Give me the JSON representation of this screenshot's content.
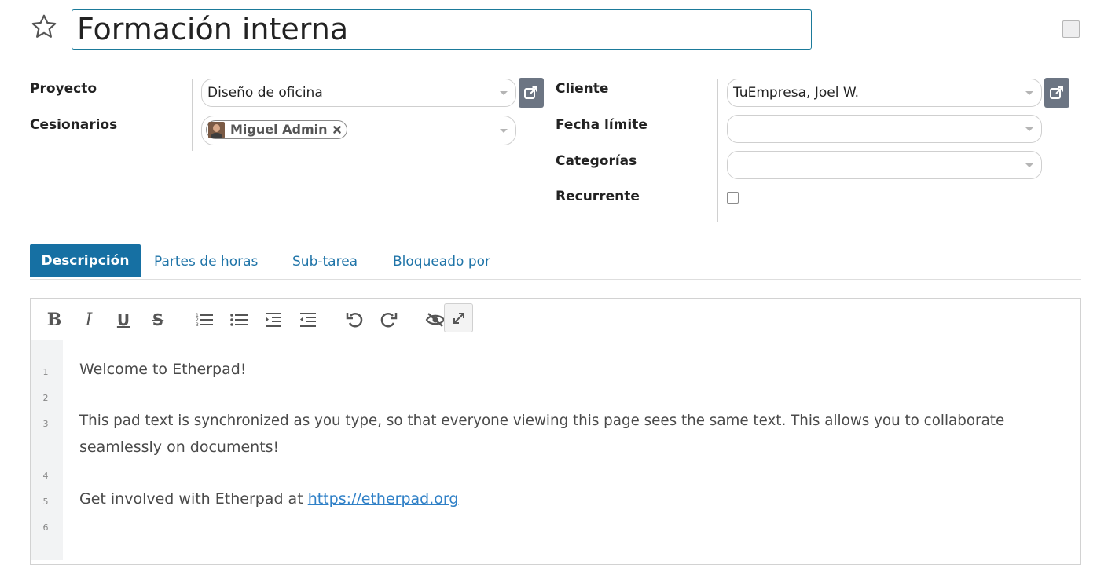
{
  "header": {
    "title": "Formación interna",
    "star_icon": "star-outline-icon"
  },
  "form": {
    "left": {
      "project_label": "Proyecto",
      "project_value": "Diseño de oficina",
      "assignees_label": "Cesionarios",
      "assignees": [
        {
          "name": "Miguel Admin"
        }
      ]
    },
    "right": {
      "client_label": "Cliente",
      "client_value": "TuEmpresa, Joel W.",
      "deadline_label": "Fecha límite",
      "deadline_value": "",
      "categories_label": "Categorías",
      "categories_value": "",
      "recurrent_label": "Recurrente",
      "recurrent_checked": false
    }
  },
  "tabs": [
    {
      "label": "Descripción",
      "active": true
    },
    {
      "label": "Partes de horas",
      "active": false
    },
    {
      "label": "Sub-tarea",
      "active": false
    },
    {
      "label": "Bloqueado por",
      "active": false
    }
  ],
  "editor": {
    "toolbar": [
      "bold-icon",
      "italic-icon",
      "underline-icon",
      "strikethrough-icon",
      "ordered-list-icon",
      "unordered-list-icon",
      "indent-icon",
      "outdent-icon",
      "undo-icon",
      "redo-icon",
      "hide-icon",
      "fullscreen-icon"
    ],
    "line_numbers": [
      "1",
      "2",
      "3",
      "4",
      "5",
      "6"
    ],
    "lines": {
      "l1": "Welcome to Etherpad!",
      "l3a": "This pad text is synchronized as you type, so that everyone viewing this page sees the same text. This allows you to collaborate",
      "l3b": "seamlessly on documents!",
      "l5_prefix": "Get involved with Etherpad at ",
      "l5_link": "https://etherpad.org"
    }
  },
  "colors": {
    "accent": "#1670a3",
    "link": "#2f80c7",
    "title_border": "#1b7a9a",
    "ext_button": "#6c7583"
  }
}
